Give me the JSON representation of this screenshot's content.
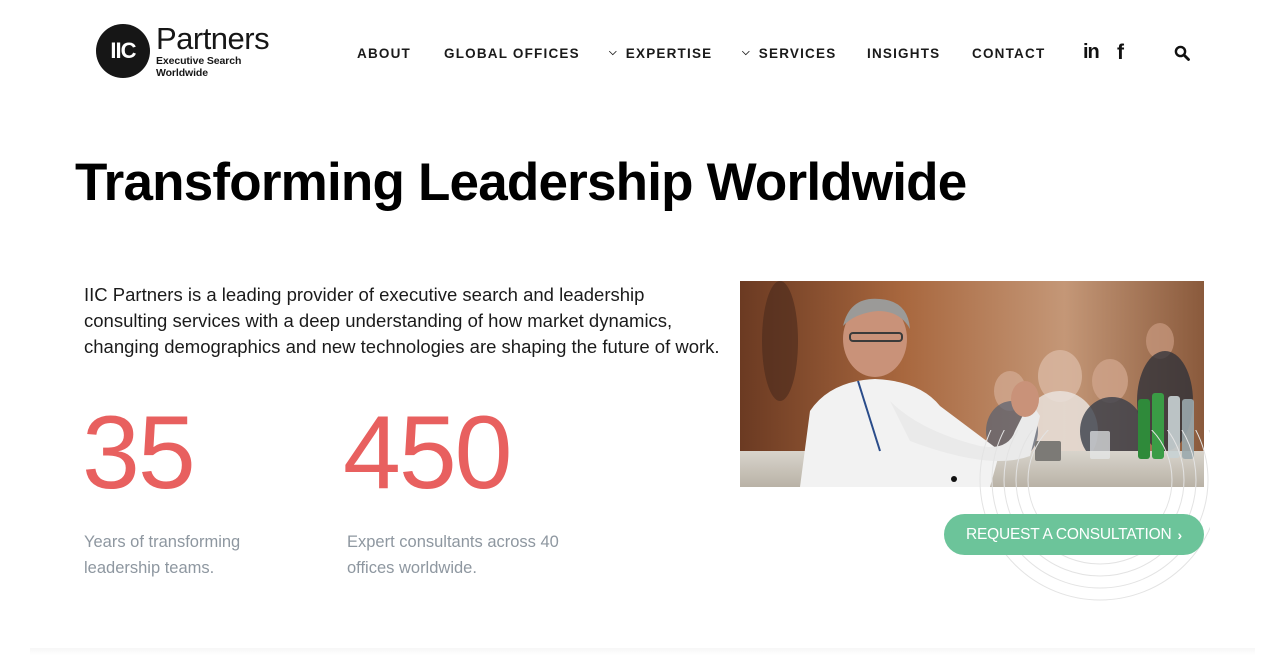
{
  "header": {
    "logo": {
      "badge": "IIC",
      "name": "Partners",
      "tagline": "Executive Search Worldwide"
    },
    "nav": [
      {
        "label": "ABOUT",
        "has_dropdown": false
      },
      {
        "label": "GLOBAL OFFICES",
        "has_dropdown": false
      },
      {
        "label": "EXPERTISE",
        "has_dropdown": true
      },
      {
        "label": "SERVICES",
        "has_dropdown": true
      },
      {
        "label": "INSIGHTS",
        "has_dropdown": false
      },
      {
        "label": "CONTACT",
        "has_dropdown": false
      }
    ],
    "social": [
      {
        "icon": "linkedin-icon",
        "glyph": "in"
      },
      {
        "icon": "facebook-icon",
        "glyph": "f"
      }
    ],
    "search_icon": "search-icon"
  },
  "hero": {
    "title": "Transforming Leadership Worldwide",
    "intro": "IIC Partners is a leading provider of executive search and leadership consulting services with a deep understanding of how market dynamics, changing demographics and new technologies are shaping the future of work."
  },
  "stats": [
    {
      "value": "35",
      "caption": "Years of transforming leadership teams."
    },
    {
      "value": "450",
      "caption": "Expert consultants across 40 offices worldwide."
    }
  ],
  "cta": {
    "label": "REQUEST A CONSULTATION",
    "icon": "chevron-right-icon"
  },
  "colors": {
    "accent_red": "#e8605f",
    "cta_green": "#6cc49a",
    "caption_gray": "#8e97a0"
  }
}
